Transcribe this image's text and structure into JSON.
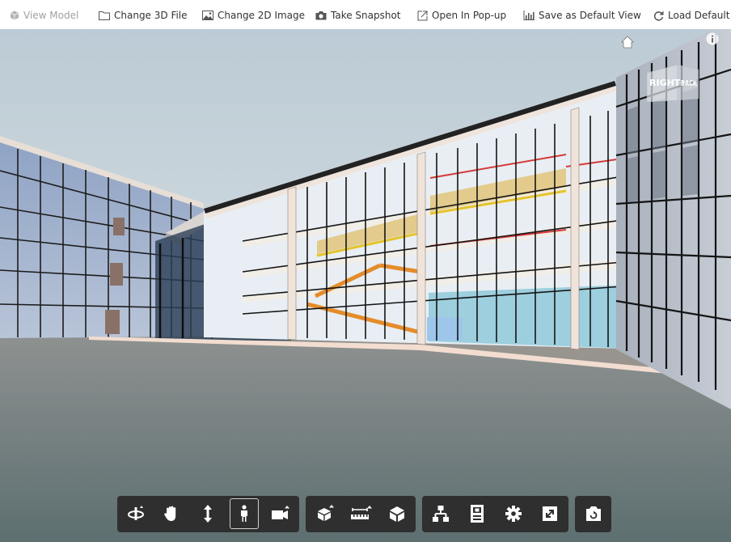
{
  "top_toolbar": {
    "view_model": "View Model",
    "change_3d_file": "Change 3D File",
    "change_2d_image": "Change 2D Image",
    "take_snapshot": "Take Snapshot",
    "open_in_popup": "Open In Pop-up",
    "save_default_view": "Save as Default View",
    "load_default_view": "Load Default View"
  },
  "viewcube": {
    "face_right": "RIGHT",
    "face_back": "BACK"
  },
  "nav_toolbar": {
    "active_tool": "first-person",
    "groups": [
      [
        "orbit-icon",
        "pan-icon",
        "zoom-icon",
        "first-person-icon",
        "camera-icon"
      ],
      [
        "explode-icon",
        "measure-icon",
        "section-icon"
      ],
      [
        "model-browser-icon",
        "properties-icon",
        "settings-icon",
        "fullscreen-icon"
      ],
      [
        "reset-view-icon"
      ]
    ]
  },
  "colors": {
    "toolbar_bg": "#2f2f2f",
    "toolbar_icon": "#ffffff",
    "sky_top": "#c3d0d9",
    "ground": "#6c7a7b"
  }
}
